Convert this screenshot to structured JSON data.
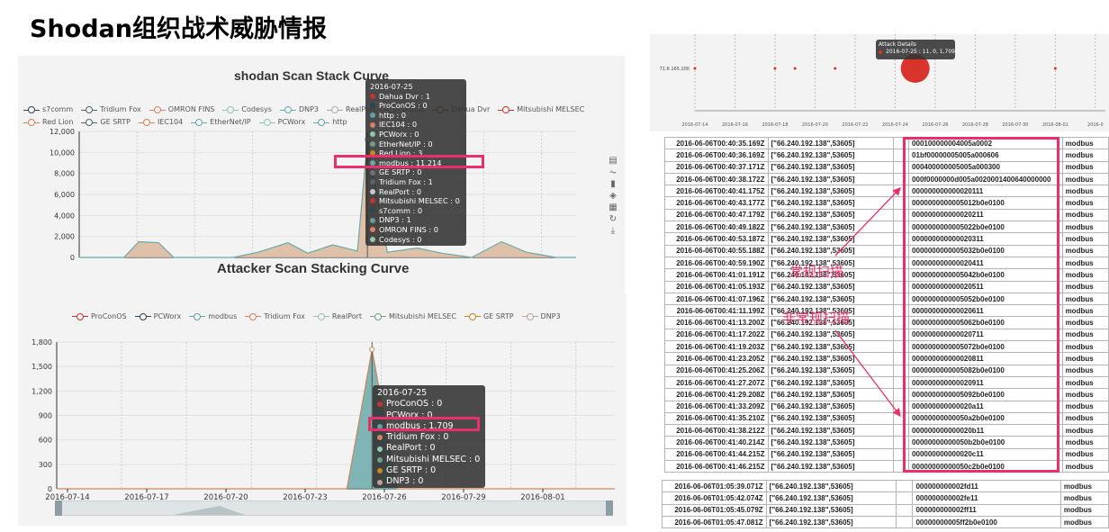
{
  "page_title": "Shodan组织战术威胁情报",
  "colors": {
    "highlight": "#e8316b",
    "modbus": "#6aa9a8",
    "tan": "#d9b79a"
  },
  "chart_data": [
    {
      "type": "area",
      "title": "shodan Scan Stack Curve",
      "legend": [
        "s7comm",
        "Tridium Fox",
        "OMRON FINS",
        "Codesys",
        "DNP3",
        "RealPort",
        "modbus",
        "Dahua Dvr",
        "Mitsubishi MELSEC",
        "Red Lion",
        "GE SRTP",
        "IEC104",
        "EtherNet/IP",
        "PCWorx",
        "http"
      ],
      "legend_colors": [
        "#2f4554",
        "#546570",
        "#d48265",
        "#91c7ae",
        "#6aa9a8",
        "#aaaaaa",
        "#888888",
        "#c23531",
        "#c23531",
        "#d48265",
        "#546570",
        "#d48265",
        "#6aa9a8",
        "#91c7ae",
        "#6aa9a8"
      ],
      "legend_visible_text": [
        "s7comm",
        "Tridium Fox",
        "OMRON FINS",
        "Codesys",
        "DNP3",
        "RealPort",
        "odbus",
        "Dahua Dvr",
        "Mitsubishi MELSEC",
        "Red Lion",
        "GE SRTP",
        "IEC104",
        "EtherNet/IP",
        "PCWorx",
        "http"
      ],
      "ylim": [
        0,
        12000
      ],
      "yticks": [
        "12,000",
        "10,000",
        "8,000",
        "6,000",
        "4,000",
        "2,000",
        "0"
      ],
      "series": [
        {
          "name": "modbus",
          "points": [
            [
              0.0,
              0
            ],
            [
              0.09,
              0
            ],
            [
              0.12,
              1500
            ],
            [
              0.16,
              1400
            ],
            [
              0.19,
              0
            ],
            [
              0.24,
              0
            ],
            [
              0.31,
              0
            ],
            [
              0.36,
              500
            ],
            [
              0.42,
              1400
            ],
            [
              0.46,
              400
            ],
            [
              0.51,
              1200
            ],
            [
              0.56,
              600
            ],
            [
              0.58,
              11214
            ],
            [
              0.62,
              500
            ],
            [
              0.68,
              900
            ],
            [
              0.73,
              400
            ],
            [
              0.79,
              0
            ],
            [
              0.85,
              1500
            ],
            [
              0.9,
              500
            ],
            [
              0.96,
              0
            ],
            [
              1.0,
              0
            ]
          ]
        }
      ],
      "tooltip": {
        "date": "2016-07-25",
        "items": [
          {
            "label": "Dahua Dvr : 1",
            "color": "#c23531"
          },
          {
            "label": "ProConOS : 0",
            "color": "#2f4554"
          },
          {
            "label": "http : 0",
            "color": "#61a0a8"
          },
          {
            "label": "IEC104 : 0",
            "color": "#d48265"
          },
          {
            "label": "PCWorx : 0",
            "color": "#91c7ae"
          },
          {
            "label": "EtherNet/IP : 0",
            "color": "#749f83"
          },
          {
            "label": "Red Lion : 3",
            "color": "#ca8622"
          },
          {
            "label": "modbus : 11,214",
            "color": "#6aa9a8"
          },
          {
            "label": "GE SRTP : 0",
            "color": "#6e7074"
          },
          {
            "label": "Tridium Fox : 1",
            "color": "#546570"
          },
          {
            "label": "RealPort : 0",
            "color": "#c4ccd3"
          },
          {
            "label": "Mitsubishi MELSEC : 0",
            "color": "#c23531"
          },
          {
            "label": "s7comm : 0",
            "color": "#2f4554"
          },
          {
            "label": "DNP3 : 1",
            "color": "#61a0a8"
          },
          {
            "label": "OMRON FINS : 0",
            "color": "#d48265"
          },
          {
            "label": "Codesys : 0",
            "color": "#91c7ae"
          }
        ]
      }
    },
    {
      "type": "area",
      "title": "Attacker Scan Stacking Curve",
      "legend": [
        "ProConOS",
        "PCWorx",
        "modbus",
        "Tridium Fox",
        "RealPort",
        "Mitsubishi MELSEC",
        "GE SRTP",
        "DNP3"
      ],
      "legend_colors": [
        "#c23531",
        "#2f4554",
        "#61a0a8",
        "#d48265",
        "#91c7ae",
        "#749f83",
        "#ca8622",
        "#bda29a"
      ],
      "ylim": [
        0,
        1800
      ],
      "yticks": [
        "1,800",
        "1,500",
        "1,200",
        "900",
        "600",
        "300",
        "0"
      ],
      "xticks": [
        "2016-07-14",
        "2016-07-17",
        "2016-07-20",
        "2016-07-23",
        "2016-07-26",
        "2016-07-29",
        "2016-08-01"
      ],
      "series": [
        {
          "name": "modbus",
          "points": [
            [
              0.0,
              0
            ],
            [
              0.52,
              0
            ],
            [
              0.565,
              1709
            ],
            [
              0.61,
              0
            ],
            [
              1.0,
              0
            ]
          ]
        }
      ],
      "tooltip": {
        "date": "2016-07-25",
        "items": [
          {
            "label": "ProConOS : 0",
            "color": "#c23531"
          },
          {
            "label": "PCWorx : 0",
            "color": "#2f4554"
          },
          {
            "label": "modbus : 1,709",
            "color": "#61a0a8"
          },
          {
            "label": "Tridium Fox : 0",
            "color": "#d48265"
          },
          {
            "label": "RealPort : 0",
            "color": "#91c7ae"
          },
          {
            "label": "Mitsubishi MELSEC : 0",
            "color": "#749f83"
          },
          {
            "label": "GE SRTP : 0",
            "color": "#ca8622"
          },
          {
            "label": "DNP3 : 0",
            "color": "#bda29a"
          }
        ]
      }
    },
    {
      "type": "scatter",
      "ylabel_tick": "71.6.165.200",
      "xticks": [
        "2016-07-14",
        "2016-07-16",
        "2016-07-18",
        "2016-07-20",
        "2016-07-22",
        "2016-07-24",
        "2016-07-26",
        "2016-07-28",
        "2016-07-30",
        "2016-08-01",
        "2016-0"
      ],
      "points": [
        {
          "date": "2016-07-14",
          "value": 1
        },
        {
          "date": "2016-07-18",
          "value": 1
        },
        {
          "date": "2016-07-19",
          "value": 1
        },
        {
          "date": "2016-07-21",
          "value": 1
        },
        {
          "date": "2016-07-25",
          "value": 11,
          "big": true
        },
        {
          "date": "2016-08-01",
          "value": 1
        }
      ],
      "tooltip": {
        "title": "Attack Details",
        "item": "2016-07-25 : 11, 0, 1,709"
      }
    },
    {
      "type": "table",
      "rows": [
        [
          "2016-06-06T00:40:35.169Z",
          "[\"66.240.192.138\",53605]",
          "000100000004005a0002",
          "modbus"
        ],
        [
          "2016-06-06T00:40:36.169Z",
          "[\"66.240.192.138\",53605]",
          "01bf00000005005a000606",
          "modbus"
        ],
        [
          "2016-06-06T00:40:37.171Z",
          "[\"66.240.192.138\",53605]",
          "000400000005005a000300",
          "modbus"
        ],
        [
          "2016-06-06T00:40:38.172Z",
          "[\"66.240.192.138\",53605]",
          "000f0000000d005a0020001400640000000",
          "modbus"
        ],
        [
          "2016-06-06T00:40:41.175Z",
          "[\"66.240.192.138\",53605]",
          "000000000000020111",
          "modbus"
        ],
        [
          "2016-06-06T00:40:43.177Z",
          "[\"66.240.192.138\",53605]",
          "0000000000005012b0e0100",
          "modbus"
        ],
        [
          "2016-06-06T00:40:47.179Z",
          "[\"66.240.192.138\",53605]",
          "000000000000020211",
          "modbus"
        ],
        [
          "2016-06-06T00:40:49.182Z",
          "[\"66.240.192.138\",53605]",
          "0000000000005022b0e0100",
          "modbus"
        ],
        [
          "2016-06-06T00:40:53.187Z",
          "[\"66.240.192.138\",53605]",
          "000000000000020311",
          "modbus"
        ],
        [
          "2016-06-06T00:40:55.188Z",
          "[\"66.240.192.138\",53605]",
          "0000000000005032b0e0100",
          "modbus"
        ],
        [
          "2016-06-06T00:40:59.190Z",
          "[\"66.240.192.138\",53605]",
          "000000000000020411",
          "modbus"
        ],
        [
          "2016-06-06T00:41:01.191Z",
          "[\"66.240.192.138\",53605]",
          "0000000000005042b0e0100",
          "modbus"
        ],
        [
          "2016-06-06T00:41:05.193Z",
          "[\"66.240.192.138\",53605]",
          "000000000000020511",
          "modbus"
        ],
        [
          "2016-06-06T00:41:07.196Z",
          "[\"66.240.192.138\",53605]",
          "0000000000005052b0e0100",
          "modbus"
        ],
        [
          "2016-06-06T00:41:11.199Z",
          "[\"66.240.192.138\",53605]",
          "000000000000020611",
          "modbus"
        ],
        [
          "2016-06-06T00:41:13.200Z",
          "[\"66.240.192.138\",53605]",
          "0000000000005062b0e0100",
          "modbus"
        ],
        [
          "2016-06-06T00:41:17.202Z",
          "[\"66.240.192.138\",53605]",
          "000000000000020711",
          "modbus"
        ],
        [
          "2016-06-06T00:41:19.203Z",
          "[\"66.240.192.138\",53605]",
          "0000000000005072b0e0100",
          "modbus"
        ],
        [
          "2016-06-06T00:41:23.205Z",
          "[\"66.240.192.138\",53605]",
          "000000000000020811",
          "modbus"
        ],
        [
          "2016-06-06T00:41:25.206Z",
          "[\"66.240.192.138\",53605]",
          "0000000000005082b0e0100",
          "modbus"
        ],
        [
          "2016-06-06T00:41:27.207Z",
          "[\"66.240.192.138\",53605]",
          "000000000000020911",
          "modbus"
        ],
        [
          "2016-06-06T00:41:29.208Z",
          "[\"66.240.192.138\",53605]",
          "0000000000005092b0e0100",
          "modbus"
        ],
        [
          "2016-06-06T00:41:33.209Z",
          "[\"66.240.192.138\",53605]",
          "000000000000020a11",
          "modbus"
        ],
        [
          "2016-06-06T00:41:35.210Z",
          "[\"66.240.192.138\",53605]",
          "00000000000050a2b0e0100",
          "modbus"
        ],
        [
          "2016-06-06T00:41:38.212Z",
          "[\"66.240.192.138\",53605]",
          "000000000000020b11",
          "modbus"
        ],
        [
          "2016-06-06T00:41:40.214Z",
          "[\"66.240.192.138\",53605]",
          "00000000000050b2b0e0100",
          "modbus"
        ],
        [
          "2016-06-06T00:41:44.215Z",
          "[\"66.240.192.138\",53605]",
          "000000000000020c11",
          "modbus"
        ],
        [
          "2016-06-06T00:41:46.215Z",
          "[\"66.240.192.138\",53605]",
          "00000000000050c2b0e0100",
          "modbus"
        ]
      ],
      "rows2": [
        [
          "2016-06-06T01:05:39.071Z",
          "[\"66.240.192.138\",53605]",
          "000000000002fd11",
          "modbus"
        ],
        [
          "2016-06-06T01:05:42.074Z",
          "[\"66.240.192.138\",53605]",
          "000000000002fe11",
          "modbus"
        ],
        [
          "2016-06-06T01:05:45.079Z",
          "[\"66.240.192.138\",53605]",
          "000000000002ff11",
          "modbus"
        ],
        [
          "2016-06-06T01:05:47.081Z",
          "[\"66.240.192.138\",53605]",
          "00000000005ff2b0e0100",
          "modbus"
        ]
      ],
      "annotations": [
        "常规扫描",
        "非常规扫描"
      ]
    }
  ]
}
